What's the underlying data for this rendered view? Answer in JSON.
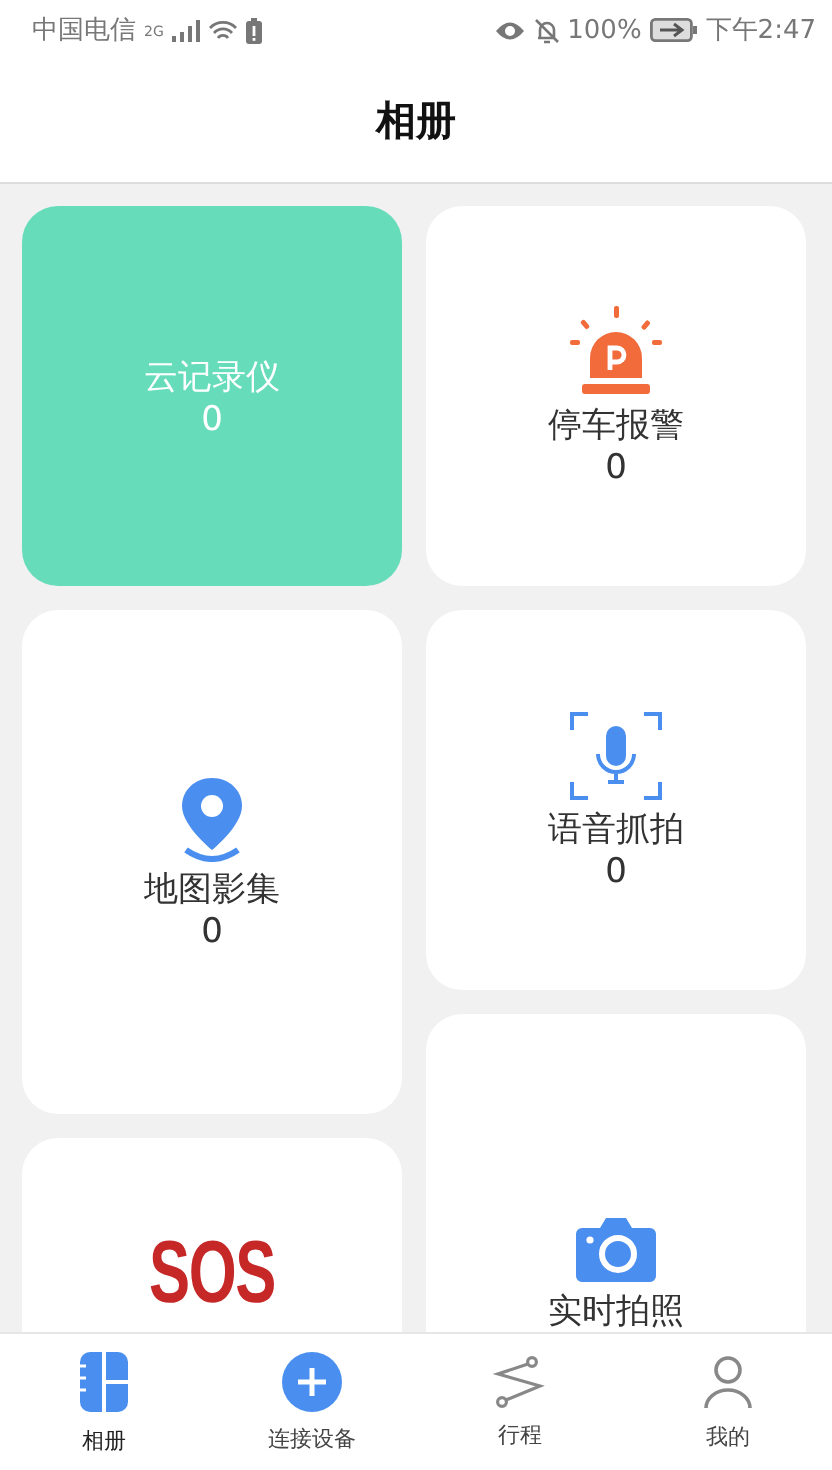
{
  "status_bar": {
    "carrier": "中国电信",
    "network": "2G",
    "battery": "100%",
    "time": "下午2:47"
  },
  "header": {
    "title": "相册"
  },
  "columns": [
    [
      {
        "kind": "cloud",
        "label": "云记录仪",
        "count": "0",
        "highlighted": true
      },
      {
        "kind": "map",
        "label": "地图影集",
        "count": "0",
        "highlighted": false
      },
      {
        "kind": "sos",
        "badge": "SOS",
        "highlighted": false
      }
    ],
    [
      {
        "kind": "parking",
        "label": "停车报警",
        "count": "0",
        "highlighted": false
      },
      {
        "kind": "voice",
        "label": "语音抓拍",
        "count": "0",
        "highlighted": false
      },
      {
        "kind": "photo",
        "label": "实时拍照",
        "highlighted": false
      }
    ]
  ],
  "tab_bar": [
    {
      "kind": "album",
      "label": "相册",
      "selected": true
    },
    {
      "kind": "connect",
      "label": "连接设备",
      "selected": false
    },
    {
      "kind": "route",
      "label": "行程",
      "selected": false
    },
    {
      "kind": "profile",
      "label": "我的",
      "selected": false
    }
  ]
}
